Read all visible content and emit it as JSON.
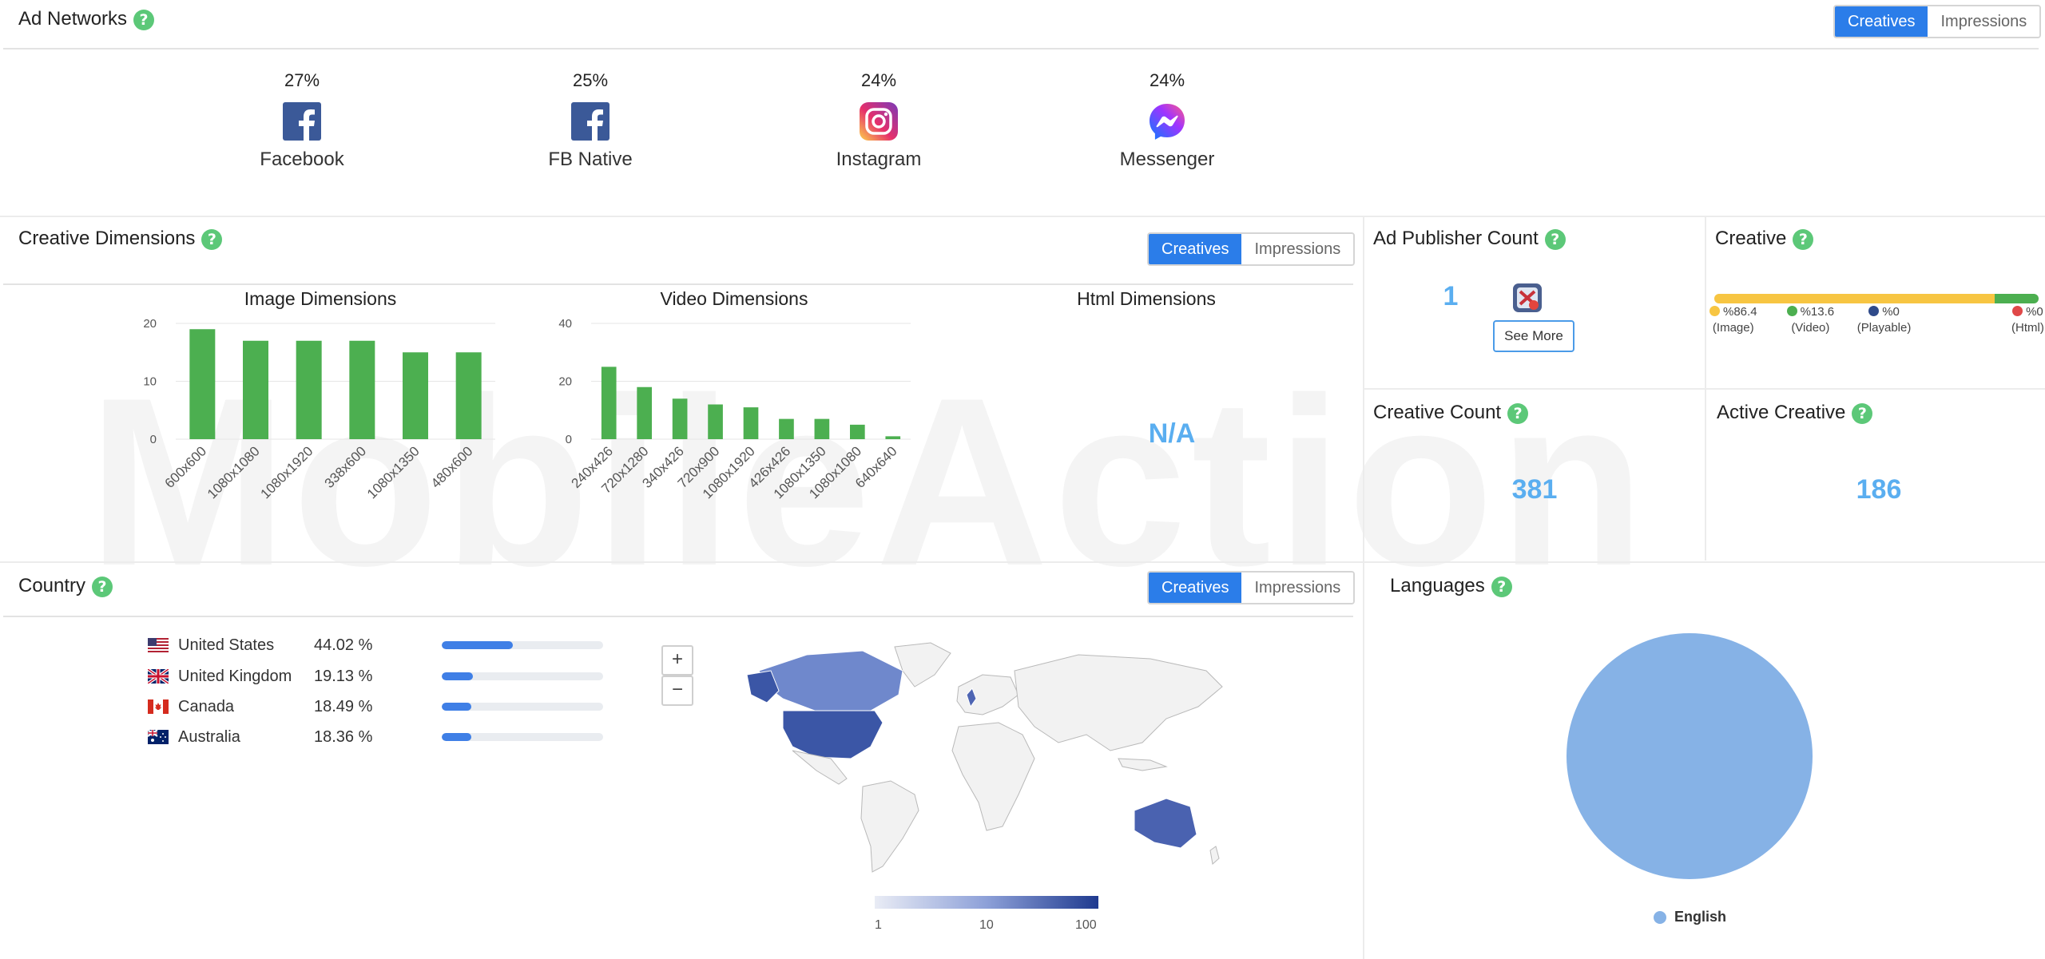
{
  "ad_networks": {
    "title": "Ad Networks",
    "help": "?",
    "toggle": {
      "creatives": "Creatives",
      "impressions": "Impressions"
    },
    "items": [
      {
        "pct": "27%",
        "name": "Facebook",
        "icon": "facebook-icon"
      },
      {
        "pct": "25%",
        "name": "FB Native",
        "icon": "facebook-icon"
      },
      {
        "pct": "24%",
        "name": "Instagram",
        "icon": "instagram-icon"
      },
      {
        "pct": "24%",
        "name": "Messenger",
        "icon": "messenger-icon"
      }
    ]
  },
  "creative_dimensions": {
    "title": "Creative Dimensions",
    "help": "?",
    "toggle": {
      "creatives": "Creatives",
      "impressions": "Impressions"
    },
    "html_title": "Html Dimensions",
    "html_value": "N/A"
  },
  "chart_data": [
    {
      "type": "bar",
      "title": "Image Dimensions",
      "categories": [
        "600x600",
        "1080x1080",
        "1080x1920",
        "338x600",
        "1080x1350",
        "480x600"
      ],
      "values": [
        19,
        17,
        17,
        17,
        15,
        15
      ],
      "yticks": [
        0,
        10,
        20
      ],
      "ylim": [
        0,
        20
      ],
      "color": "#4caf50"
    },
    {
      "type": "bar",
      "title": "Video Dimensions",
      "categories": [
        "240x426",
        "720x1280",
        "340x426",
        "720x900",
        "1080x1920",
        "426x426",
        "1080x1350",
        "1080x1080",
        "640x640"
      ],
      "values": [
        25,
        18,
        14,
        12,
        11,
        7,
        7,
        5,
        1
      ],
      "yticks": [
        0,
        20,
        40
      ],
      "ylim": [
        0,
        40
      ],
      "color": "#4caf50"
    }
  ],
  "ad_publisher_count": {
    "title": "Ad Publisher Count",
    "help": "?",
    "value": "1",
    "see_more": "See More"
  },
  "creative": {
    "title": "Creative",
    "help": "?",
    "segments": [
      {
        "label": "%86.4",
        "sub": "(Image)",
        "value": 86.4,
        "color": "#f7c542"
      },
      {
        "label": "%13.6",
        "sub": "(Video)",
        "value": 13.6,
        "color": "#4caf50"
      },
      {
        "label": "%0",
        "sub": "(Playable)",
        "value": 0,
        "color": "#2f4a8a"
      },
      {
        "label": "%0",
        "sub": "(Html)",
        "value": 0,
        "color": "#e04848"
      }
    ]
  },
  "creative_count": {
    "title": "Creative Count",
    "help": "?",
    "value": "381"
  },
  "active_creative": {
    "title": "Active Creative",
    "help": "?",
    "value": "186"
  },
  "country": {
    "title": "Country",
    "help": "?",
    "toggle": {
      "creatives": "Creatives",
      "impressions": "Impressions"
    },
    "rows": [
      {
        "name": "United States",
        "pct": "44.02 %",
        "value": 44.02,
        "flag": "us-flag"
      },
      {
        "name": "United Kingdom",
        "pct": "19.13 %",
        "value": 19.13,
        "flag": "uk-flag"
      },
      {
        "name": "Canada",
        "pct": "18.49 %",
        "value": 18.49,
        "flag": "canada-flag"
      },
      {
        "name": "Australia",
        "pct": "18.36 %",
        "value": 18.36,
        "flag": "australia-flag"
      }
    ],
    "zoom_in": "+",
    "zoom_out": "−",
    "legend": [
      "1",
      "10",
      "100"
    ]
  },
  "languages": {
    "title": "Languages",
    "help": "?",
    "chart_data": {
      "type": "pie",
      "labels": [
        "English"
      ],
      "values": [
        100
      ],
      "colors": [
        "#86b2e6"
      ]
    },
    "legend_label": "English"
  },
  "watermark": "MobileAction"
}
